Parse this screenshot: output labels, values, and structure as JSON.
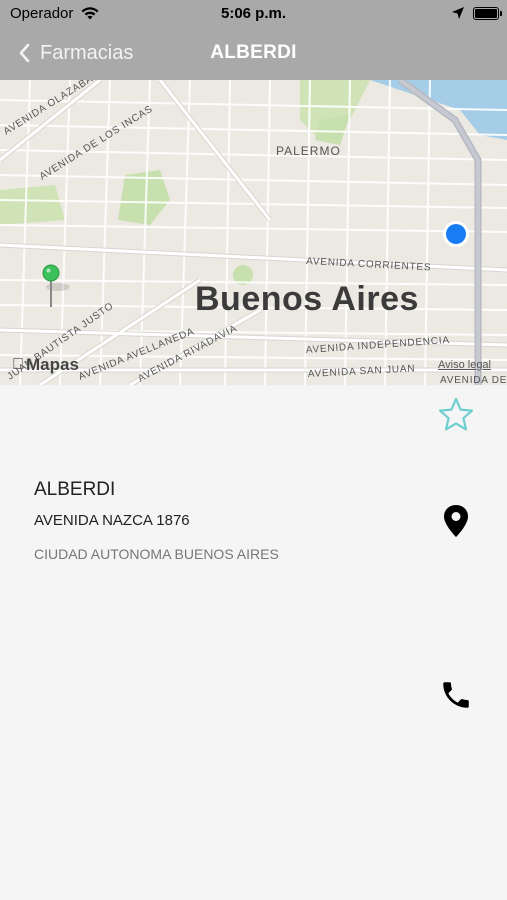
{
  "status_bar": {
    "carrier": "Operador",
    "time": "5:06 p.m."
  },
  "nav": {
    "back_label": "Farmacias",
    "title": "ALBERDI"
  },
  "map": {
    "district": "PALERMO",
    "city": "Buenos Aires",
    "streets": [
      "AVENIDA OLAZABAL",
      "AVENIDA DE LOS INCAS",
      "AVENIDA CORRIENTES",
      "AVENIDA INDEPENDENCIA",
      "AVENIDA SAN JUAN",
      "AVENIDA DE GARAY",
      "AVENIDA AVELLANEDA",
      "AVENIDA RIVADAVIA",
      "JUAN BAUTISTA JUSTO"
    ],
    "brand": "Mapas",
    "legal": "Aviso legal"
  },
  "pharmacy": {
    "name": "ALBERDI",
    "address": "AVENIDA NAZCA 1876",
    "city": "CIUDAD AUTONOMA BUENOS AIRES"
  },
  "colors": {
    "header": "#a9a9a9",
    "star": "#6ecfcf",
    "user_dot": "#1a7cf5",
    "pin": "#3cc15a"
  }
}
